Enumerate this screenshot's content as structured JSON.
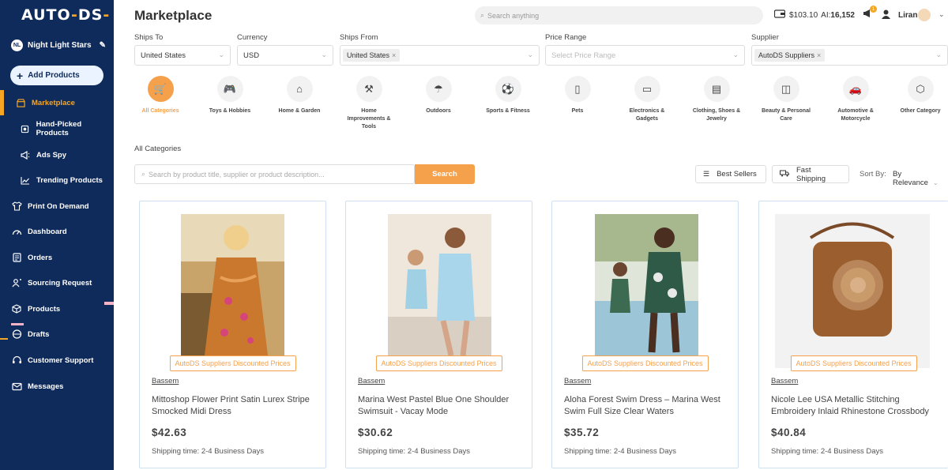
{
  "brand": {
    "logo_main": "AUTO",
    "logo_dash": "-",
    "logo_end": "DS",
    "logo_tail": "-"
  },
  "store": {
    "initials": "NL",
    "name": "Night Light Stars"
  },
  "sidebar": {
    "add_products": "Add Products",
    "items": [
      {
        "label": "Marketplace",
        "icon": "store-icon"
      },
      {
        "label": "Hand-Picked Products",
        "icon": "badge-icon"
      },
      {
        "label": "Ads Spy",
        "icon": "megaphone-icon"
      },
      {
        "label": "Trending Products",
        "icon": "trend-icon"
      },
      {
        "label": "Print On Demand",
        "icon": "shirt-icon"
      },
      {
        "label": "Dashboard",
        "icon": "gauge-icon"
      },
      {
        "label": "Orders",
        "icon": "orders-icon"
      },
      {
        "label": "Sourcing Request",
        "icon": "sourcing-icon"
      },
      {
        "label": "Products",
        "icon": "box-icon"
      },
      {
        "label": "Drafts",
        "icon": "drafts-icon"
      },
      {
        "label": "Customer Support",
        "icon": "support-icon"
      },
      {
        "label": "Messages",
        "icon": "mail-icon"
      }
    ]
  },
  "header": {
    "title": "Marketplace",
    "search_placeholder": "Search anything",
    "balance": "$103.10",
    "ai_label": "AI:",
    "ai_credits": "16,152",
    "notif_count": "1",
    "user_name": "Liran"
  },
  "filters": {
    "ships_to": {
      "label": "Ships To",
      "value": "United States"
    },
    "currency": {
      "label": "Currency",
      "value": "USD"
    },
    "ships_from": {
      "label": "Ships From",
      "tag": "United States"
    },
    "price_range": {
      "label": "Price Range",
      "placeholder": "Select Price Range"
    },
    "supplier": {
      "label": "Supplier",
      "tag": "AutoDS Suppliers"
    }
  },
  "categories": [
    {
      "label": "All Categories",
      "icon": "cart-icon",
      "glyph": "🛒"
    },
    {
      "label": "Toys & Hobbies",
      "icon": "gamepad-icon",
      "glyph": "🎮"
    },
    {
      "label": "Home & Garden",
      "icon": "home-icon",
      "glyph": "⌂"
    },
    {
      "label": "Home Improvements & Tools",
      "icon": "tools-icon",
      "glyph": "⚒"
    },
    {
      "label": "Outdoors",
      "icon": "umbrella-icon",
      "glyph": "☂"
    },
    {
      "label": "Sports & Fitness",
      "icon": "ball-icon",
      "glyph": "⚽"
    },
    {
      "label": "Pets",
      "icon": "pets-icon",
      "glyph": "▯"
    },
    {
      "label": "Electronics & Gadgets",
      "icon": "phone-icon",
      "glyph": "▭"
    },
    {
      "label": "Clothing, Shoes & Jewelry",
      "icon": "clothing-icon",
      "glyph": "▤"
    },
    {
      "label": "Beauty & Personal Care",
      "icon": "beauty-icon",
      "glyph": "◫"
    },
    {
      "label": "Automotive & Motorcycle",
      "icon": "car-icon",
      "glyph": "🚗"
    },
    {
      "label": "Other Category",
      "icon": "cube-icon",
      "glyph": "⬡"
    }
  ],
  "breadcrumb": "All Categories",
  "product_search": {
    "placeholder": "Search by product title, supplier or product description...",
    "button": "Search"
  },
  "toolbar": {
    "best_sellers": "Best Sellers",
    "fast_shipping": "Fast Shipping",
    "sort_by_label": "Sort By:",
    "sort_by_value": "By Relevance"
  },
  "products": [
    {
      "badge": "AutoDS Suppliers Discounted Prices",
      "supplier": "Bassem",
      "title": "Mittoshop Flower Print Satin Lurex Stripe Smocked Midi Dress",
      "price": "$42.63",
      "shipping": "Shipping time: 2-4 Business Days"
    },
    {
      "badge": "AutoDS Suppliers Discounted Prices",
      "supplier": "Bassem",
      "title": "Marina West Pastel Blue One Shoulder Swimsuit - Vacay Mode",
      "price": "$30.62",
      "shipping": "Shipping time: 2-4 Business Days"
    },
    {
      "badge": "AutoDS Suppliers Discounted Prices",
      "supplier": "Bassem",
      "title": "Aloha Forest Swim Dress – Marina West Swim Full Size Clear Waters",
      "price": "$35.72",
      "shipping": "Shipping time: 2-4 Business Days"
    },
    {
      "badge": "AutoDS Suppliers Discounted Prices",
      "supplier": "Bassem",
      "title": "Nicole Lee USA Metallic Stitching Embroidery Inlaid Rhinestone Crossbody",
      "price": "$40.84",
      "shipping": "Shipping time: 2-4 Business Days"
    }
  ],
  "colors": {
    "sidebar": "#0f2b5b",
    "accent": "#f5a04b",
    "card_border": "#cfe0f3"
  }
}
